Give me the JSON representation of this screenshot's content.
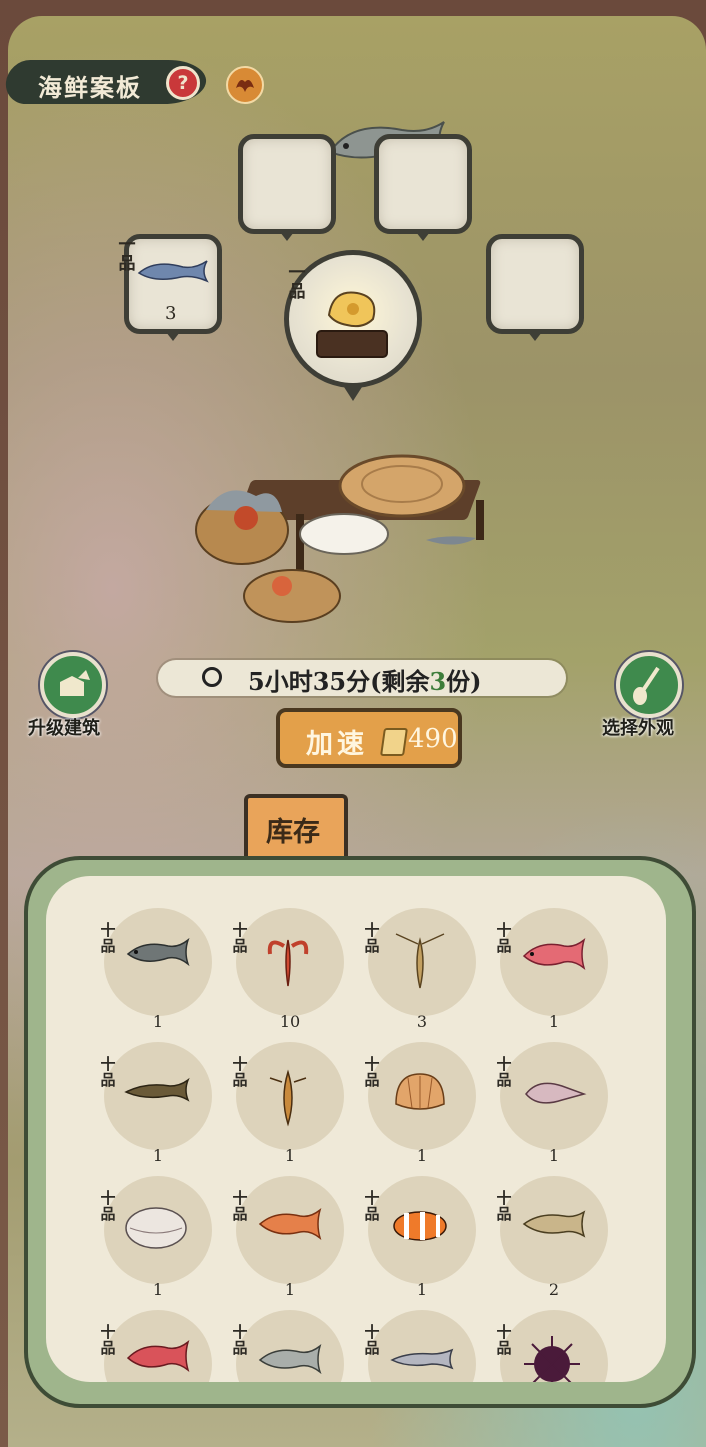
{
  "header": {
    "title": "海鲜案板",
    "help_symbol": "?"
  },
  "slots": {
    "grade": "一品",
    "left_count": "3"
  },
  "timer": {
    "prefix": "5小时35分(剩余",
    "remaining": "3",
    "suffix": "份)"
  },
  "buttons": {
    "upgrade_label": "升级建筑",
    "appearance_label": "选择外观",
    "speedup_label": "加速",
    "speedup_cost": "490"
  },
  "inventory": {
    "tab_label": "库存",
    "grade_label": "十品",
    "items": [
      {
        "icon": "carp-fish-icon",
        "count": "1"
      },
      {
        "icon": "crayfish-icon",
        "count": "10"
      },
      {
        "icon": "river-shrimp-icon",
        "count": "3"
      },
      {
        "icon": "red-snapper-icon",
        "count": "1"
      },
      {
        "icon": "catfish-icon",
        "count": "1"
      },
      {
        "icon": "mantis-shrimp-icon",
        "count": "1"
      },
      {
        "icon": "scallop-icon",
        "count": "1"
      },
      {
        "icon": "conch-icon",
        "count": "1"
      },
      {
        "icon": "clam-icon",
        "count": "1"
      },
      {
        "icon": "red-carp-icon",
        "count": "1"
      },
      {
        "icon": "clownfish-icon",
        "count": "1"
      },
      {
        "icon": "yellow-croaker-icon",
        "count": "2"
      },
      {
        "icon": "sea-bream-icon",
        "count": ""
      },
      {
        "icon": "silver-fish-icon",
        "count": ""
      },
      {
        "icon": "small-fish-icon",
        "count": ""
      },
      {
        "icon": "sea-urchin-icon",
        "count": ""
      }
    ]
  },
  "colors": {
    "accent_orange": "#e3a04a",
    "button_green": "#3f8a4d",
    "highlight_green": "#3d7d3a"
  }
}
